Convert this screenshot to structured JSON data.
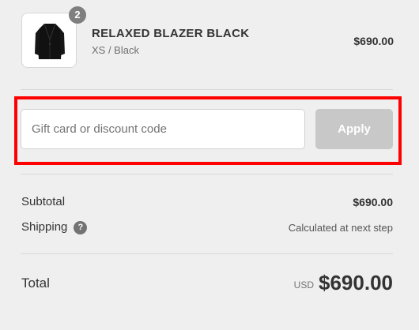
{
  "product": {
    "name": "RELAXED BLAZER BLACK",
    "variant": "XS / Black",
    "price": "$690.00",
    "quantity": "2",
    "image_icon": "blazer-image"
  },
  "discount": {
    "placeholder": "Gift card or discount code",
    "value": "",
    "apply_label": "Apply"
  },
  "summary": {
    "subtotal_label": "Subtotal",
    "subtotal_value": "$690.00",
    "shipping_label": "Shipping",
    "shipping_help_icon": "question-mark-icon",
    "shipping_help_glyph": "?",
    "shipping_value": "Calculated at next step"
  },
  "total": {
    "label": "Total",
    "currency": "USD",
    "amount": "$690.00"
  },
  "colors": {
    "highlight_border": "#ff0000",
    "apply_button_disabled": "#c8c8c8",
    "quantity_badge": "#7f7f7f"
  }
}
